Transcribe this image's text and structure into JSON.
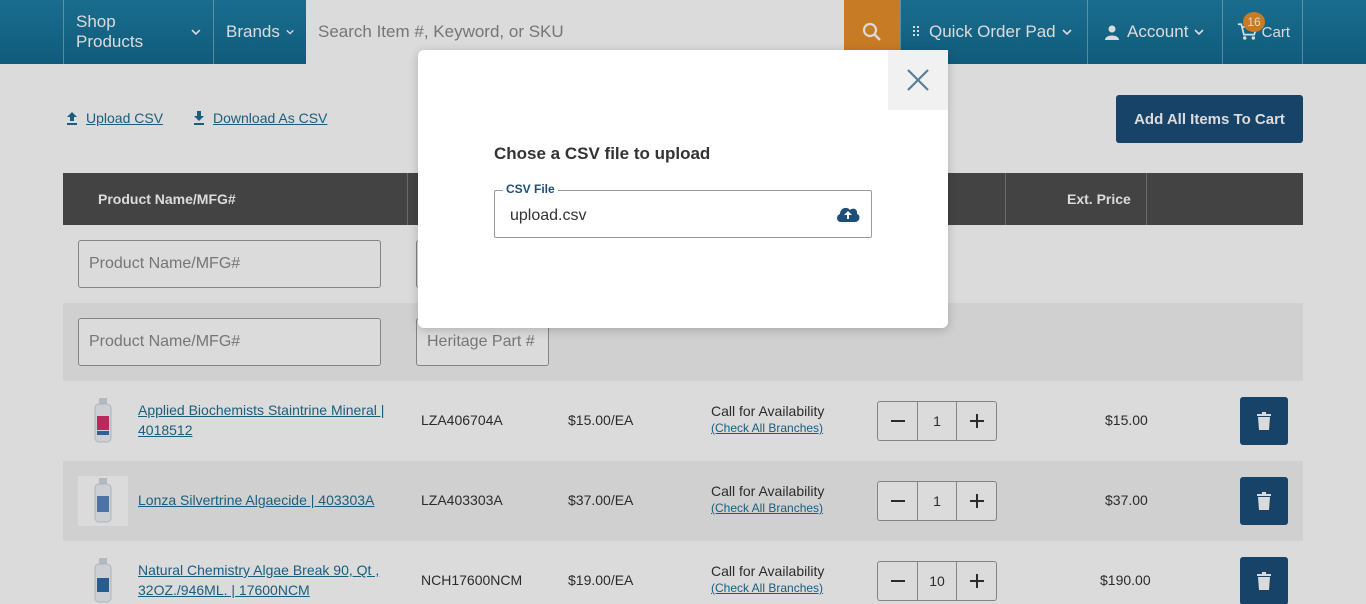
{
  "header": {
    "shop_products": "Shop Products",
    "brands": "Brands",
    "search_placeholder": "Search Item #, Keyword, or SKU",
    "quick_order_pad": "Quick Order Pad",
    "account": "Account",
    "cart": "Cart",
    "cart_count": "16"
  },
  "actions": {
    "upload_csv": "Upload CSV",
    "download_csv": "Download As CSV",
    "add_all": "Add All Items To Cart"
  },
  "table": {
    "headers": {
      "product": "Product Name/MFG#",
      "ext_price": "Ext. Price"
    },
    "filters": {
      "product_placeholder": "Product Name/MFG#",
      "heritage_placeholder": "Heritage Part #"
    },
    "rows": [
      {
        "name_line1": "Applied Biochemists Staintrine Mineral |",
        "name_line2": "4018512",
        "part": "LZA406704A",
        "price": "$15.00/EA",
        "availability": "Call for Availability",
        "check": "(Check All Branches)",
        "qty": "1",
        "ext": "$15.00"
      },
      {
        "name_line1": "Lonza Silvertrine Algaecide | 403303A",
        "name_line2": "",
        "part": "LZA403303A",
        "price": "$37.00/EA",
        "availability": "Call for Availability",
        "check": "(Check All Branches)",
        "qty": "1",
        "ext": "$37.00"
      },
      {
        "name_line1": "Natural Chemistry Algae Break 90, Qt ,",
        "name_line2": "32OZ./946ML. | 17600NCM",
        "part": "NCH17600NCM",
        "price": "$19.00/EA",
        "availability": "Call for Availability",
        "check": "(Check All Branches)",
        "qty": "10",
        "ext": "$190.00"
      }
    ]
  },
  "modal": {
    "title": "Chose a CSV file to upload",
    "field_label": "CSV File",
    "file_name": "upload.csv"
  },
  "colors": {
    "header": "#1f7fa6",
    "accent": "#e8902a",
    "primary_button": "#1d4e7a",
    "table_header": "#4f4f4f"
  }
}
